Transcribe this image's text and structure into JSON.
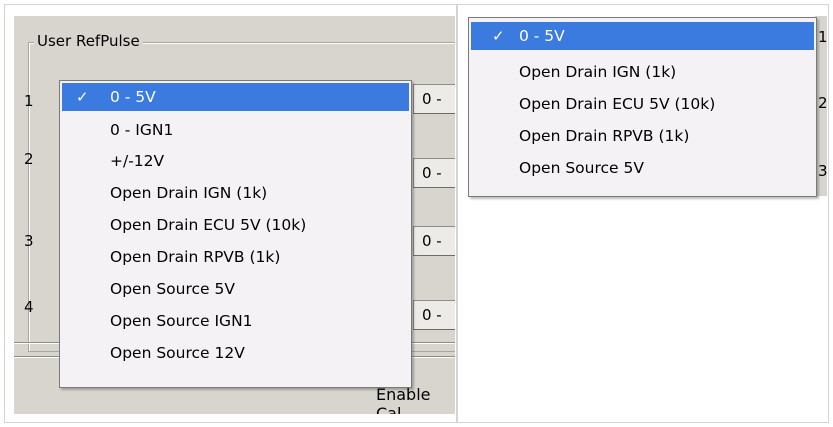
{
  "left_panel": {
    "group_title": "User RefPulse",
    "row_numbers": [
      "1",
      "2",
      "3",
      "4"
    ],
    "side_button_text": "0 -",
    "footer_text": "Enable Cal",
    "dropdown": {
      "checkmark": "✓",
      "selected_index": 0,
      "items": [
        "0 - 5V",
        "0 - IGN1",
        "+/-12V",
        "Open Drain IGN (1k)",
        "Open Drain ECU 5V (10k)",
        "Open Drain RPVB (1k)",
        "Open Source 5V",
        "Open Source IGN1",
        "Open Source 12V"
      ]
    }
  },
  "right_panel": {
    "edge_numbers": [
      "1",
      "2",
      "3"
    ],
    "dropdown": {
      "checkmark": "✓",
      "selected_index": 0,
      "items": [
        "0 - 5V",
        "Open Drain IGN (1k)",
        "Open Drain ECU 5V (10k)",
        "Open Drain RPVB (1k)",
        "Open Source 5V"
      ]
    }
  },
  "colors": {
    "dialog_bg": "#d8d5cf",
    "menu_bg": "#f4f2f5",
    "selection": "#3b7be0"
  }
}
